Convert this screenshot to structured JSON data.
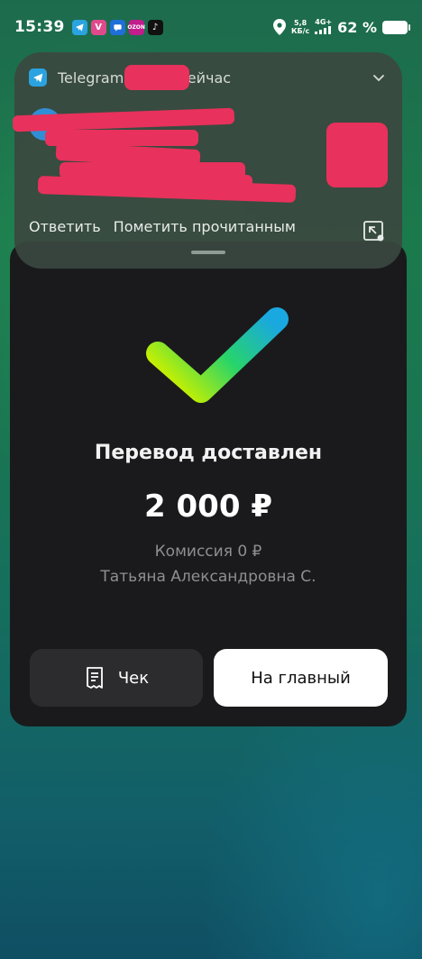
{
  "status_bar": {
    "time": "15:39",
    "apps": [
      "telegram-icon",
      "v-app-icon",
      "chat-icon",
      "ozon-icon",
      "tiktok-icon"
    ],
    "speed_value": "5,8",
    "speed_unit": "КБ/с",
    "network": "4G+",
    "battery": "62 %"
  },
  "notification": {
    "app": "Telegram",
    "sender": "/         к",
    "time": "/ Сейчас",
    "actions": {
      "reply": "Ответить",
      "mark_read": "Пометить прочитанным"
    }
  },
  "transfer": {
    "title": "Перевод доставлен",
    "amount": "2 000 ₽",
    "fee": "Комиссия 0 ₽",
    "recipient": "Татьяна Александровна С.",
    "receipt_button": "Чек",
    "home_button": "На главный"
  },
  "colors": {
    "card_bg": "#1a1a1c",
    "redaction": "#e8315c",
    "check_gradient_start": "#c7f000",
    "check_gradient_mid": "#27d46a",
    "check_gradient_end": "#1aa8e0"
  }
}
